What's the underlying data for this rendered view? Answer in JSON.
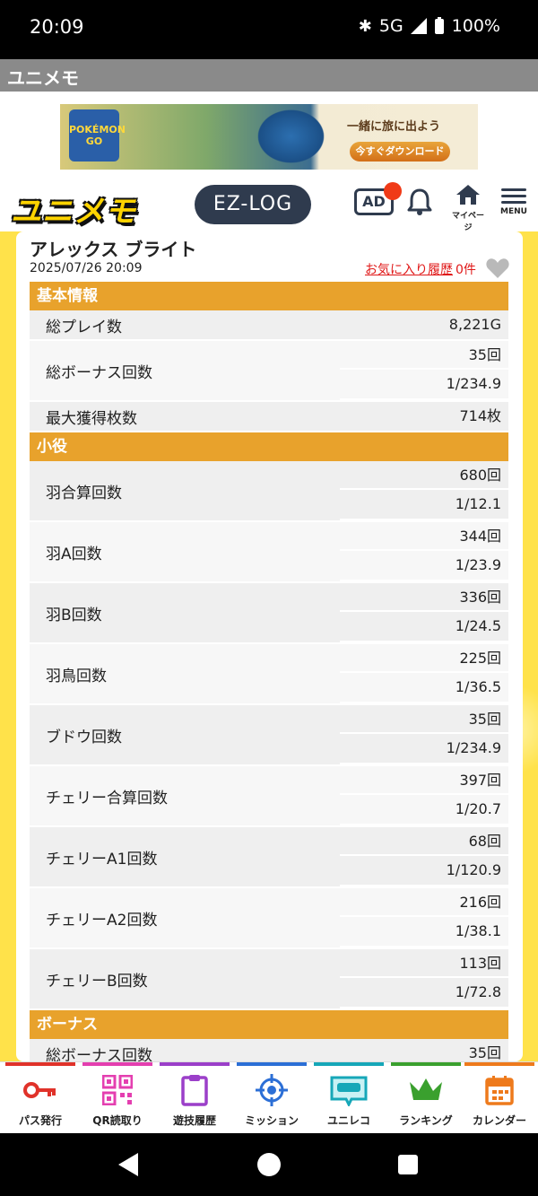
{
  "status_bar": {
    "time": "20:09",
    "network": "5G",
    "battery": "100%"
  },
  "app_title": "ユニメモ",
  "ad": {
    "logo_text": "POKÉMON GO",
    "headline": "一緒に旅に出よう",
    "cta": "今すぐダウンロード"
  },
  "header": {
    "brand": "ユニメモ",
    "ezlog": "EZ-LOG",
    "ad_badge": "AD",
    "home_label": "マイページ",
    "menu_label": "MENU"
  },
  "machine": {
    "name": "アレックス ブライト",
    "datetime": "2025/07/26 20:09",
    "favorite_link": "お気に入り履歴",
    "favorite_count": "0件"
  },
  "sections": {
    "basic": {
      "title": "基本情報",
      "rows": [
        {
          "label": "総プレイ数",
          "values": [
            "8,221G"
          ]
        },
        {
          "label": "総ボーナス回数",
          "values": [
            "35回",
            "1/234.9"
          ]
        },
        {
          "label": "最大獲得枚数",
          "values": [
            "714枚"
          ]
        }
      ]
    },
    "koyaku": {
      "title": "小役",
      "rows": [
        {
          "label": "羽合算回数",
          "values": [
            "680回",
            "1/12.1"
          ]
        },
        {
          "label": "羽A回数",
          "values": [
            "344回",
            "1/23.9"
          ]
        },
        {
          "label": "羽B回数",
          "values": [
            "336回",
            "1/24.5"
          ]
        },
        {
          "label": "羽鳥回数",
          "values": [
            "225回",
            "1/36.5"
          ]
        },
        {
          "label": "ブドウ回数",
          "values": [
            "35回",
            "1/234.9"
          ]
        },
        {
          "label": "チェリー合算回数",
          "values": [
            "397回",
            "1/20.7"
          ]
        },
        {
          "label": "チェリーA1回数",
          "values": [
            "68回",
            "1/120.9"
          ]
        },
        {
          "label": "チェリーA2回数",
          "values": [
            "216回",
            "1/38.1"
          ]
        },
        {
          "label": "チェリーB回数",
          "values": [
            "113回",
            "1/72.8"
          ]
        }
      ]
    },
    "bonus": {
      "title": "ボーナス",
      "rows": [
        {
          "label": "総ボーナス回数",
          "values": [
            "35回"
          ]
        }
      ]
    }
  },
  "bottom_nav": [
    {
      "label": "パス発行",
      "icon": "key-icon",
      "color": "#e0322a"
    },
    {
      "label": "QR読取り",
      "icon": "qr-icon",
      "color": "#e43fb0"
    },
    {
      "label": "遊技履歴",
      "icon": "clipboard-icon",
      "color": "#9b3fc9"
    },
    {
      "label": "ミッション",
      "icon": "crosshair-icon",
      "color": "#2c6fd6"
    },
    {
      "label": "ユニレコ",
      "icon": "unireco-icon",
      "color": "#16a7b8"
    },
    {
      "label": "ランキング",
      "icon": "crown-icon",
      "color": "#3aa02e"
    },
    {
      "label": "カレンダー",
      "icon": "calendar-icon",
      "color": "#ee7a1c"
    }
  ]
}
